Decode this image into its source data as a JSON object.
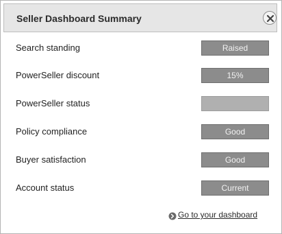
{
  "header": {
    "title": "Seller Dashboard Summary",
    "close_icon": "close-icon"
  },
  "rows": [
    {
      "label": "Search standing",
      "value": "Raised"
    },
    {
      "label": "PowerSeller discount",
      "value": "15%"
    },
    {
      "label": "PowerSeller status",
      "value": ""
    },
    {
      "label": "Policy compliance",
      "value": "Good"
    },
    {
      "label": "Buyer satisfaction",
      "value": "Good"
    },
    {
      "label": "Account status",
      "value": "Current"
    }
  ],
  "footer": {
    "link_label": "Go to your dashboard",
    "link_icon": "arrow-right-circle-icon"
  },
  "colors": {
    "header_bg": "#e6e6e6",
    "pill_bg": "#8c8c8c",
    "pill_text": "#f2f2f2"
  }
}
